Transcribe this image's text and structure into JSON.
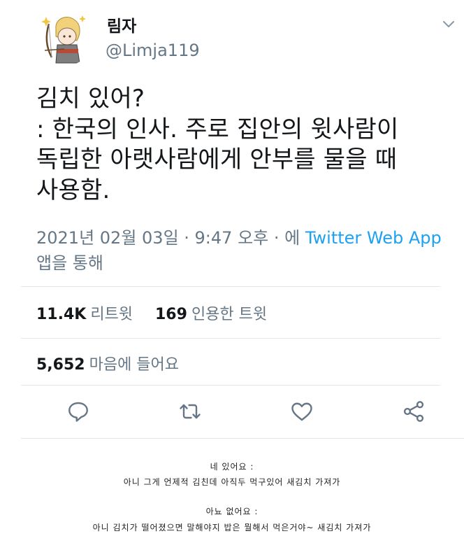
{
  "author": {
    "display_name": "림자",
    "handle": "@Limja119"
  },
  "tweet": {
    "text": "김치 있어?\n: 한국의 인사. 주로 집안의 윗사람이\n독립한 아랫사람에게 안부를 물을 때\n사용함.",
    "date_time": "2021년 02월 03일 · 9:47 오후 · 에 ",
    "source": "Twitter Web App",
    "via": "앱을 통해"
  },
  "stats": {
    "retweets_count": "11.4K",
    "retweets_label": "리트윗",
    "quotes_count": "169",
    "quotes_label": "인용한 트윗",
    "likes_count": "5,652",
    "likes_label": "마음에 들어요"
  },
  "actions": [
    "reply-icon",
    "retweet-icon",
    "like-icon",
    "share-icon"
  ],
  "colors": {
    "text": "#14171a",
    "secondary": "#657786",
    "link": "#1da1f2",
    "divider": "#e1e8ed"
  },
  "captions": [
    {
      "heading": "네 있어요 :",
      "line": "아니 그게 언제적 김친데 아직두 먹구있어 새김치 가져가"
    },
    {
      "heading": "아뇨 없어요 :",
      "line": "아니 김치가 떨어졌으면 말해야지 밥은 뭘해서 먹은거야~ 새김치 가져가"
    }
  ]
}
